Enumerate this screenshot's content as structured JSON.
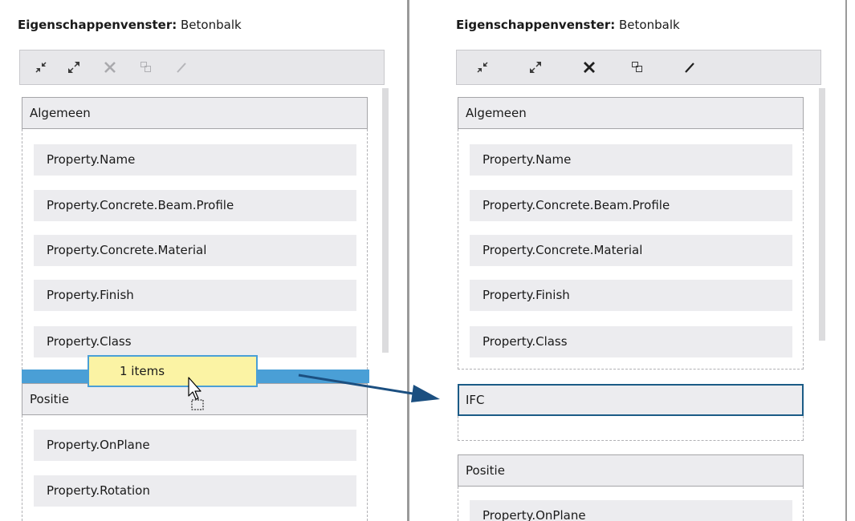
{
  "left_panel": {
    "title_label": "Eigenschappenvenster:",
    "title_object": "Betonbalk",
    "toolbar": [
      {
        "icon": "collapse-all-icon",
        "enabled": true
      },
      {
        "icon": "expand-all-icon",
        "enabled": true
      },
      {
        "icon": "delete-icon",
        "enabled": false
      },
      {
        "icon": "add-group-icon",
        "enabled": false
      },
      {
        "icon": "rename-icon",
        "enabled": false
      }
    ],
    "groups": [
      {
        "header": "Algemeen",
        "items": [
          "Property.Name",
          "Property.Concrete.Beam.Profile",
          "Property.Concrete.Material",
          "Property.Finish",
          "Property.Class"
        ]
      },
      {
        "header": "Positie",
        "items": [
          "Property.OnPlane",
          "Property.Rotation"
        ]
      }
    ],
    "drag_tooltip": "1 items"
  },
  "right_panel": {
    "title_label": "Eigenschappenvenster:",
    "title_object": "Betonbalk",
    "toolbar": [
      {
        "icon": "collapse-all-icon",
        "enabled": true
      },
      {
        "icon": "expand-all-icon",
        "enabled": true
      },
      {
        "icon": "delete-icon",
        "enabled": true
      },
      {
        "icon": "add-group-icon",
        "enabled": true
      },
      {
        "icon": "rename-icon",
        "enabled": true
      }
    ],
    "groups": [
      {
        "header": "Algemeen",
        "items": [
          "Property.Name",
          "Property.Concrete.Beam.Profile",
          "Property.Concrete.Material",
          "Property.Finish",
          "Property.Class"
        ]
      },
      {
        "header": "IFC",
        "selected": true,
        "items": []
      },
      {
        "header": "Positie",
        "items": [
          "Property.OnPlane"
        ]
      }
    ]
  },
  "colors": {
    "accent_blue": "#4a9fd6",
    "selection_border": "#1b5b86",
    "tooltip_yellow": "#fbf3a4",
    "arrow": "#1b4f80"
  }
}
